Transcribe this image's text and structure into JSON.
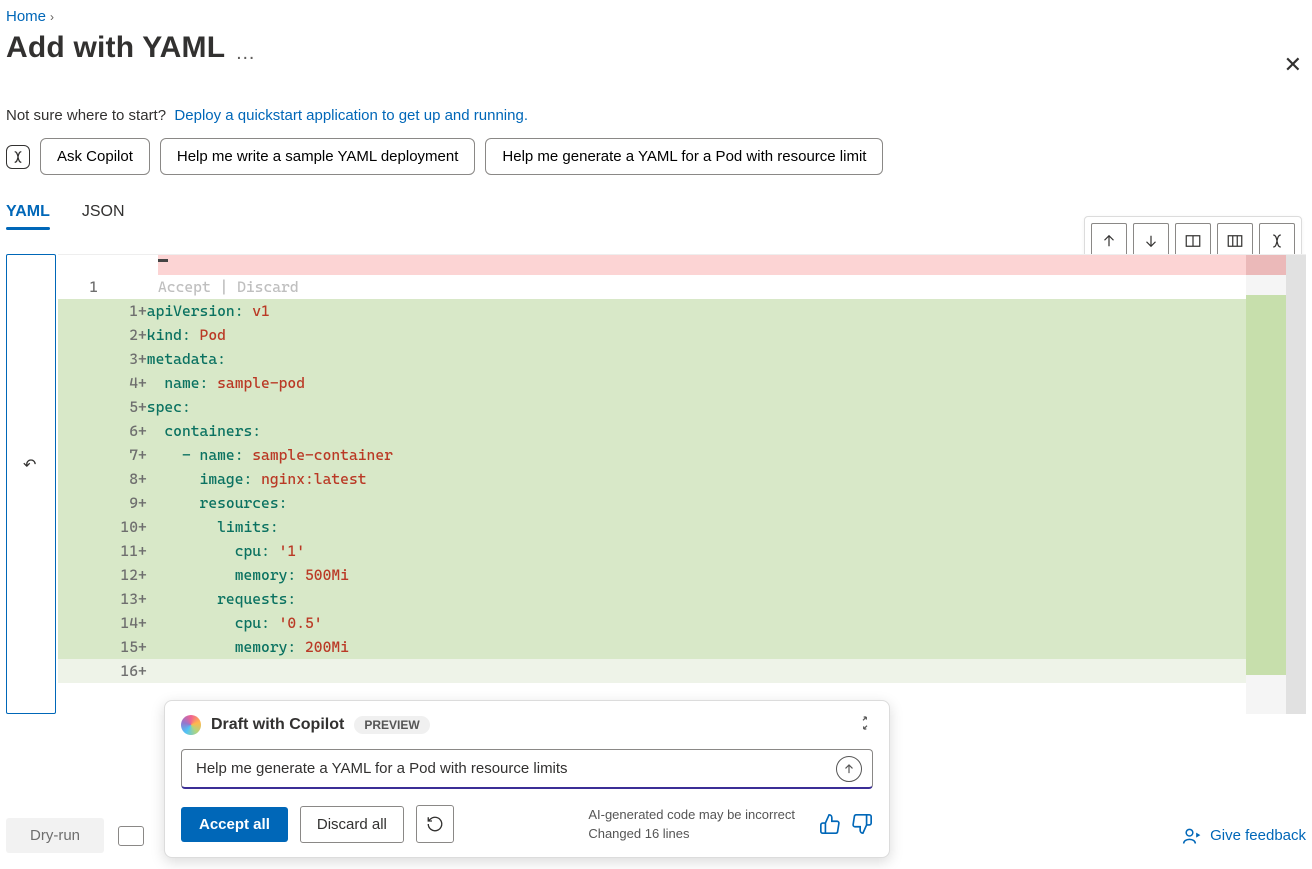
{
  "breadcrumb": {
    "home": "Home"
  },
  "title": "Add with YAML",
  "helper": {
    "question": "Not sure where to start?",
    "link": "Deploy a quickstart application to get up and running."
  },
  "suggestions": {
    "ask": "Ask Copilot",
    "s1": "Help me write a sample YAML deployment",
    "s2": "Help me generate a YAML for a Pod with resource limit"
  },
  "tabs": {
    "yaml": "YAML",
    "json": "JSON"
  },
  "editor": {
    "original_line": "1",
    "accept_discard": "Accept | Discard",
    "lines": [
      {
        "n": "1",
        "plus": "+",
        "tokens": [
          [
            "key",
            "apiVersion"
          ],
          [
            "colon",
            ": "
          ],
          [
            "val",
            "v1"
          ]
        ]
      },
      {
        "n": "2",
        "plus": "+",
        "tokens": [
          [
            "key",
            "kind"
          ],
          [
            "colon",
            ": "
          ],
          [
            "val",
            "Pod"
          ]
        ]
      },
      {
        "n": "3",
        "plus": "+",
        "tokens": [
          [
            "key",
            "metadata"
          ],
          [
            "colon",
            ":"
          ]
        ]
      },
      {
        "n": "4",
        "plus": "+",
        "tokens": [
          [
            "txt",
            "  "
          ],
          [
            "key",
            "name"
          ],
          [
            "colon",
            ": "
          ],
          [
            "val",
            "sample-pod"
          ]
        ]
      },
      {
        "n": "5",
        "plus": "+",
        "tokens": [
          [
            "key",
            "spec"
          ],
          [
            "colon",
            ":"
          ]
        ]
      },
      {
        "n": "6",
        "plus": "+",
        "tokens": [
          [
            "txt",
            "  "
          ],
          [
            "key",
            "containers"
          ],
          [
            "colon",
            ":"
          ]
        ]
      },
      {
        "n": "7",
        "plus": "+",
        "tokens": [
          [
            "txt",
            "    "
          ],
          [
            "key",
            "- name"
          ],
          [
            "colon",
            ": "
          ],
          [
            "val",
            "sample-container"
          ]
        ]
      },
      {
        "n": "8",
        "plus": "+",
        "tokens": [
          [
            "txt",
            "      "
          ],
          [
            "key",
            "image"
          ],
          [
            "colon",
            ": "
          ],
          [
            "val",
            "nginx:latest"
          ]
        ]
      },
      {
        "n": "9",
        "plus": "+",
        "tokens": [
          [
            "txt",
            "      "
          ],
          [
            "key",
            "resources"
          ],
          [
            "colon",
            ":"
          ]
        ]
      },
      {
        "n": "10",
        "plus": "+",
        "tokens": [
          [
            "txt",
            "        "
          ],
          [
            "key",
            "limits"
          ],
          [
            "colon",
            ":"
          ]
        ]
      },
      {
        "n": "11",
        "plus": "+",
        "tokens": [
          [
            "txt",
            "          "
          ],
          [
            "key",
            "cpu"
          ],
          [
            "colon",
            ": "
          ],
          [
            "str",
            "'1'"
          ]
        ]
      },
      {
        "n": "12",
        "plus": "+",
        "tokens": [
          [
            "txt",
            "          "
          ],
          [
            "key",
            "memory"
          ],
          [
            "colon",
            ": "
          ],
          [
            "val",
            "500Mi"
          ]
        ]
      },
      {
        "n": "13",
        "plus": "+",
        "tokens": [
          [
            "txt",
            "        "
          ],
          [
            "key",
            "requests"
          ],
          [
            "colon",
            ":"
          ]
        ]
      },
      {
        "n": "14",
        "plus": "+",
        "tokens": [
          [
            "txt",
            "          "
          ],
          [
            "key",
            "cpu"
          ],
          [
            "colon",
            ": "
          ],
          [
            "str",
            "'0.5'"
          ]
        ]
      },
      {
        "n": "15",
        "plus": "+",
        "tokens": [
          [
            "txt",
            "          "
          ],
          [
            "key",
            "memory"
          ],
          [
            "colon",
            ": "
          ],
          [
            "val",
            "200Mi"
          ]
        ]
      },
      {
        "n": "16",
        "plus": "+",
        "tokens": []
      }
    ]
  },
  "copilot": {
    "title": "Draft with Copilot",
    "badge": "PREVIEW",
    "input": "Help me generate a YAML for a Pod with resource limits",
    "accept": "Accept all",
    "discard": "Discard all",
    "warn": "AI-generated code may be incorrect",
    "changed": "Changed 16 lines"
  },
  "bottom": {
    "dryrun": "Dry-run",
    "feedback": "Give feedback"
  }
}
